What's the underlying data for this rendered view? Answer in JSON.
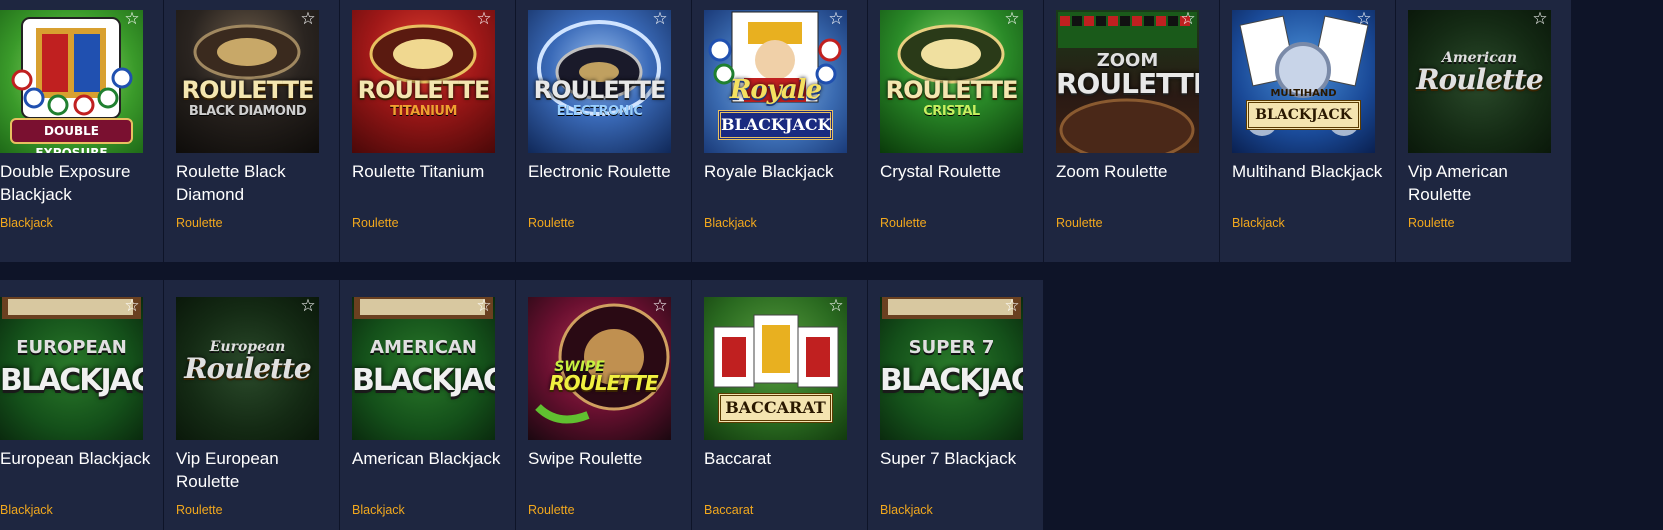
{
  "favorite_icon": "star-outline-icon",
  "colors": {
    "page_background": "#0e1428",
    "card_background": "#1e2640",
    "category_text": "#f2a81d",
    "title_text": "#ffffff"
  },
  "games": [
    {
      "title": "Double Exposure Blackjack",
      "category": "Blackjack",
      "art_text": "DOUBLE EXPOSURE"
    },
    {
      "title": "Roulette Black Diamond",
      "category": "Roulette",
      "art_text": "ROULETTE",
      "art_sub": "BLACK DIAMOND"
    },
    {
      "title": "Roulette Titanium",
      "category": "Roulette",
      "art_text": "ROULETTE",
      "art_sub": "TITANIUM"
    },
    {
      "title": "Electronic Roulette",
      "category": "Roulette",
      "art_text": "ROULETTE",
      "art_sub": "ELECTRONIC"
    },
    {
      "title": "Royale Blackjack",
      "category": "Blackjack",
      "art_text": "Royale",
      "art_sub": "BLACKJACK"
    },
    {
      "title": "Crystal Roulette",
      "category": "Roulette",
      "art_text": "ROULETTE",
      "art_sub": "CRISTAL"
    },
    {
      "title": "Zoom Roulette",
      "category": "Roulette",
      "art_pre": "ZOOM",
      "art_text": "ROULETTE"
    },
    {
      "title": "Multihand Blackjack",
      "category": "Blackjack",
      "art_pre": "MULTIHAND",
      "art_text": "BLACKJACK"
    },
    {
      "title": "Vip American Roulette",
      "category": "Roulette",
      "art_pre": "American",
      "art_text": "Roulette"
    },
    {
      "title": "European Blackjack",
      "category": "Blackjack",
      "art_pre": "EUROPEAN",
      "art_text": "BLACKJACK"
    },
    {
      "title": "Vip European Roulette",
      "category": "Roulette",
      "art_pre": "European",
      "art_text": "Roulette"
    },
    {
      "title": "American Blackjack",
      "category": "Blackjack",
      "art_pre": "AMERICAN",
      "art_text": "BLACKJACK"
    },
    {
      "title": "Swipe Roulette",
      "category": "Roulette",
      "art_pre": "SWIPE",
      "art_text": "ROULETTE"
    },
    {
      "title": "Baccarat",
      "category": "Baccarat",
      "art_text": "BACCARAT"
    },
    {
      "title": "Super 7 Blackjack",
      "category": "Blackjack",
      "art_pre": "SUPER 7",
      "art_text": "BLACKJACK"
    }
  ]
}
